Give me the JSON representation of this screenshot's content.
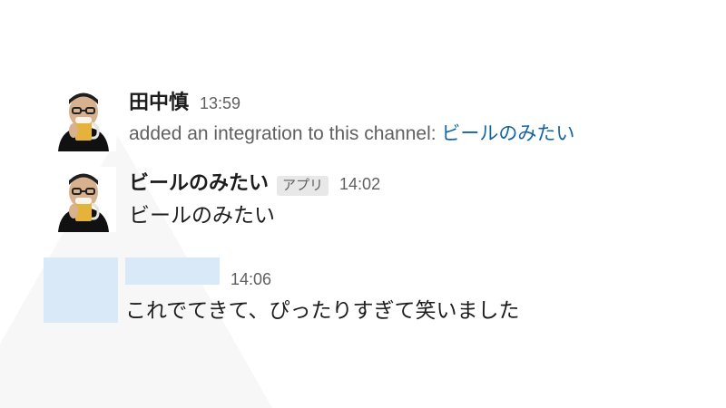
{
  "messages": [
    {
      "sender": "田中慎",
      "time": "13:59",
      "text": "added an integration to this channel: ",
      "link": "ビールのみたい"
    },
    {
      "sender": "ビールのみたい",
      "badge": "アプリ",
      "time": "14:02",
      "text": "ビールのみたい"
    },
    {
      "time": "14:06",
      "text": "これでてきて、ぴったりすぎて笑いました"
    }
  ],
  "colors": {
    "link": "#1264a3",
    "muted": "#616061",
    "placeholder": "#d9e9f7"
  }
}
